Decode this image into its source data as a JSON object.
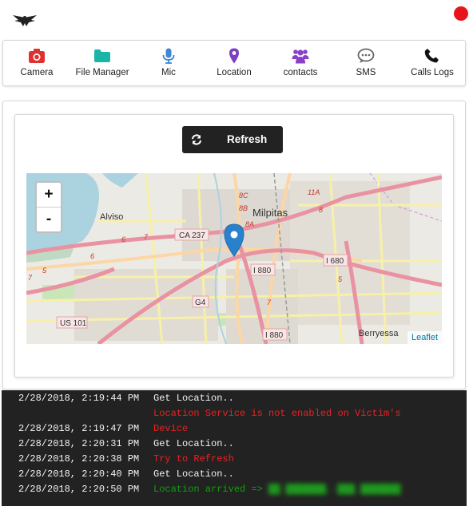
{
  "nav": {
    "items": [
      {
        "label": "Camera",
        "icon": "camera-icon",
        "color": "#e03131"
      },
      {
        "label": "File Manager",
        "icon": "folder-icon",
        "color": "#1bb5a8"
      },
      {
        "label": "Mic",
        "icon": "microphone-icon",
        "color": "#3e86d6"
      },
      {
        "label": "Location",
        "icon": "map-pin-icon",
        "color": "#7b3fc4"
      },
      {
        "label": "contacts",
        "icon": "users-icon",
        "color": "#8a3fc9"
      },
      {
        "label": "SMS",
        "icon": "chat-bubble-icon",
        "color": "#666666"
      },
      {
        "label": "Calls Logs",
        "icon": "phone-icon",
        "color": "#111111"
      }
    ]
  },
  "refresh": {
    "label": "Refresh"
  },
  "map": {
    "zoom_in": "+",
    "zoom_out": "-",
    "attribution": "Leaflet",
    "places": {
      "alviso": "Alviso",
      "milpitas": "Milpitas",
      "berryessa": "Berryessa"
    },
    "shields": {
      "ca237": "CA 237",
      "i880a": "I 880",
      "i880b": "I 880",
      "i680": "I 680",
      "us101": "US 101",
      "g4": "G4"
    },
    "numbers": {
      "n8c": "8C",
      "n8b": "8B",
      "n8a": "8A",
      "n11a": "11A",
      "n8": "8",
      "n7a": "7",
      "n6a": "6",
      "n6b": "6",
      "n5a": "5",
      "n5b": "5",
      "n7b": "7",
      "n7c": "7"
    }
  },
  "console": {
    "lines": [
      {
        "time": "2/28/2018, 2:19:44 PM",
        "message": "Get Location.."
      },
      {
        "time": "",
        "message": "Location Service is not enabled on Victim's"
      },
      {
        "time": "2/28/2018, 2:19:47 PM",
        "message": "Device"
      },
      {
        "time": "2/28/2018, 2:20:31 PM",
        "message": "Get Location.."
      },
      {
        "time": "2/28/2018, 2:20:38 PM",
        "message": "Try to Refresh"
      },
      {
        "time": "2/28/2018, 2:20:40 PM",
        "message": "Get Location.."
      },
      {
        "time": "2/28/2018, 2:20:50 PM",
        "message": "Location arrived =>"
      }
    ],
    "colors": {
      "normal": "#f2f2f2",
      "error": "#f01f1f",
      "success": "#0fa10f"
    }
  }
}
